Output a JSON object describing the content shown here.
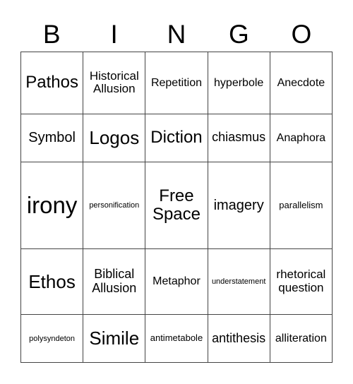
{
  "header": [
    "B",
    "I",
    "N",
    "G",
    "O"
  ],
  "grid": [
    [
      "Pathos",
      "Historical Allusion",
      "Repetition",
      "hyperbole",
      "Anecdote"
    ],
    [
      "Symbol",
      "Logos",
      "Diction",
      "chiasmus",
      "Anaphora"
    ],
    [
      "irony",
      "personification",
      "Free Space",
      "imagery",
      "parallelism"
    ],
    [
      "Ethos",
      "Biblical Allusion",
      "Metaphor",
      "understatement",
      "rhetorical question"
    ],
    [
      "polysyndeton",
      "Simile",
      "antimetabole",
      "antithesis",
      "alliteration"
    ]
  ]
}
